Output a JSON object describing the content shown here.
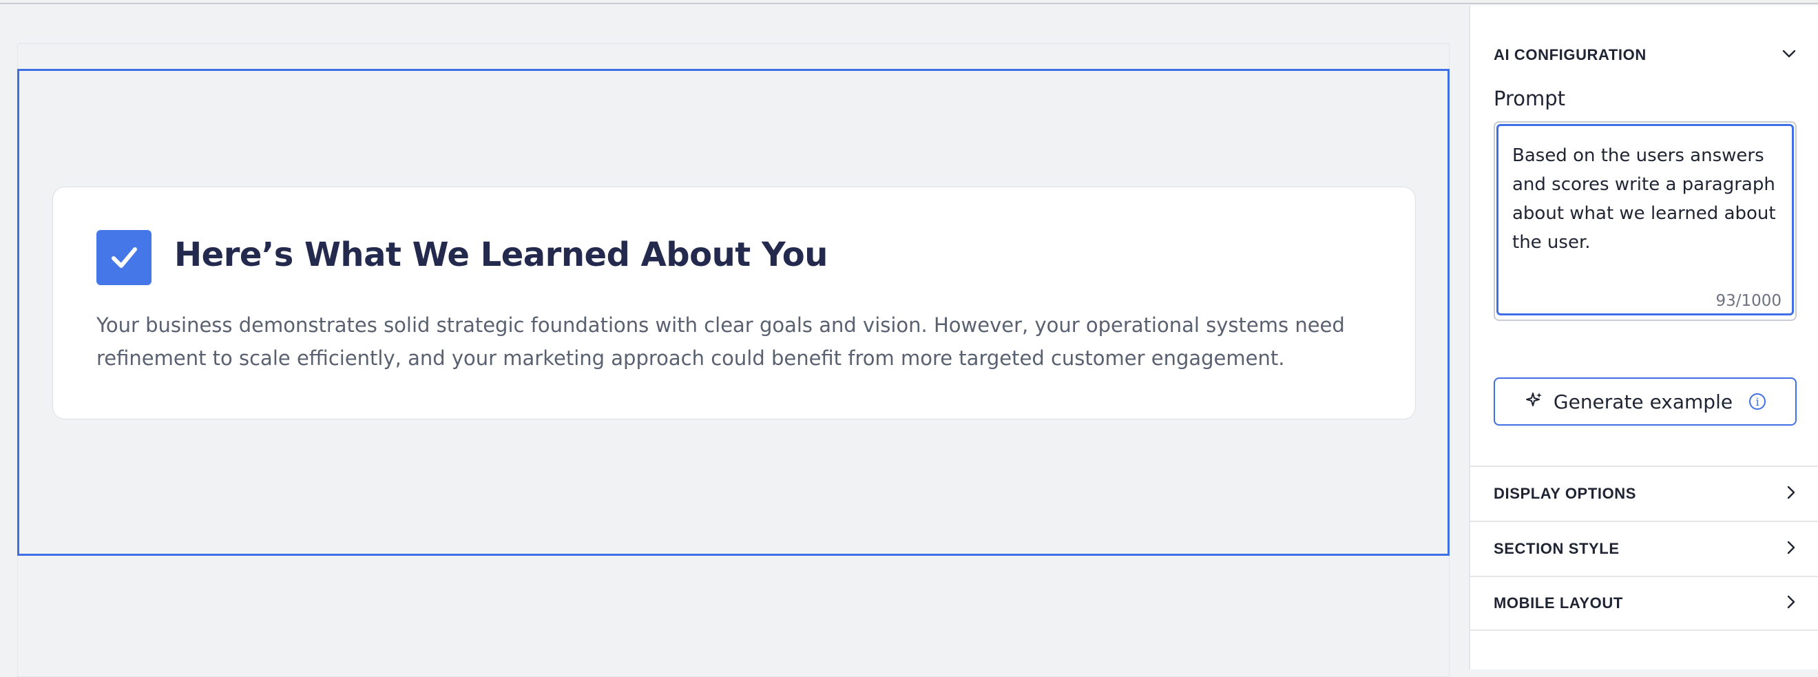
{
  "card": {
    "title": "Here’s What We Learned About You",
    "body": "Your business demonstrates solid strategic foundations with clear goals and vision. However, your operational systems need refinement to scale efficiently, and your marketing approach could benefit from more targeted customer engagement.",
    "badge_icon": "checkmark-icon",
    "badge_color": "#4577e8"
  },
  "panel": {
    "ai_configuration": {
      "label": "AI CONFIGURATION",
      "prompt_label": "Prompt",
      "prompt_value": "Based on the users answers and scores write a paragraph about what we learned about the user.",
      "char_count": "93/1000",
      "generate_label": "Generate example"
    },
    "sections": [
      {
        "label": "DISPLAY OPTIONS"
      },
      {
        "label": "SECTION STYLE"
      },
      {
        "label": "MOBILE LAYOUT"
      }
    ]
  },
  "colors": {
    "accent": "#3f6fe4",
    "title": "#232a4d",
    "canvas_bg": "#f1f2f4"
  }
}
